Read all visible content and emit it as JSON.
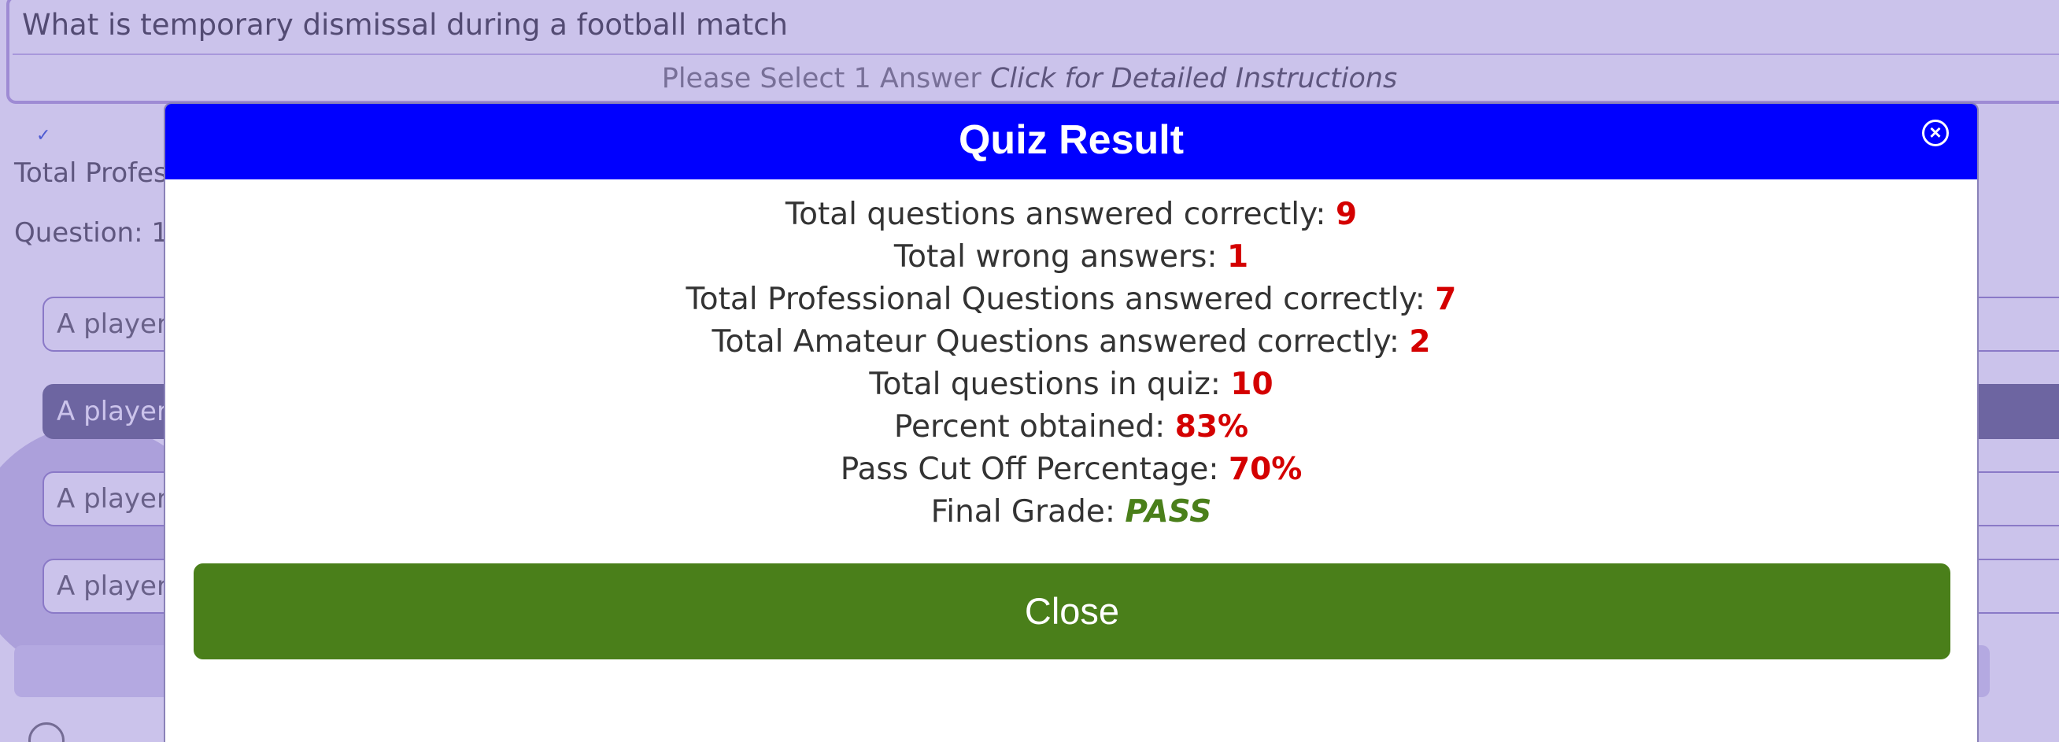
{
  "background": {
    "question": "What is temporary dismissal during a football match",
    "instructions_prefix": "Please Select 1 Answer",
    "instructions_link": "Click for Detailed Instructions",
    "stats_label_partial": "Total Profes",
    "question_counter_partial": "Question: 1",
    "answers": [
      {
        "label": "A player"
      },
      {
        "label": "A player"
      },
      {
        "label": "A player"
      },
      {
        "label": "A player"
      }
    ]
  },
  "modal": {
    "title": "Quiz Result",
    "rows": [
      {
        "label": "Total questions answered correctly:",
        "value": "9"
      },
      {
        "label": "Total wrong answers:",
        "value": "1"
      },
      {
        "label": "Total Professional Questions answered correctly:",
        "value": "7"
      },
      {
        "label": "Total Amateur Questions answered correctly:",
        "value": "2"
      },
      {
        "label": "Total questions in quiz:",
        "value": "10"
      },
      {
        "label": "Percent obtained:",
        "value": "83%"
      },
      {
        "label": "Pass Cut Off Percentage:",
        "value": "70%"
      }
    ],
    "grade": {
      "label": "Final Grade:",
      "value": "PASS"
    },
    "close_label": "Close",
    "close_icon": "close-circle-icon"
  },
  "colors": {
    "header": "#0000ff",
    "value_red": "#d40000",
    "pass_green": "#4a7f1a",
    "close_button": "#4a7f1a"
  }
}
